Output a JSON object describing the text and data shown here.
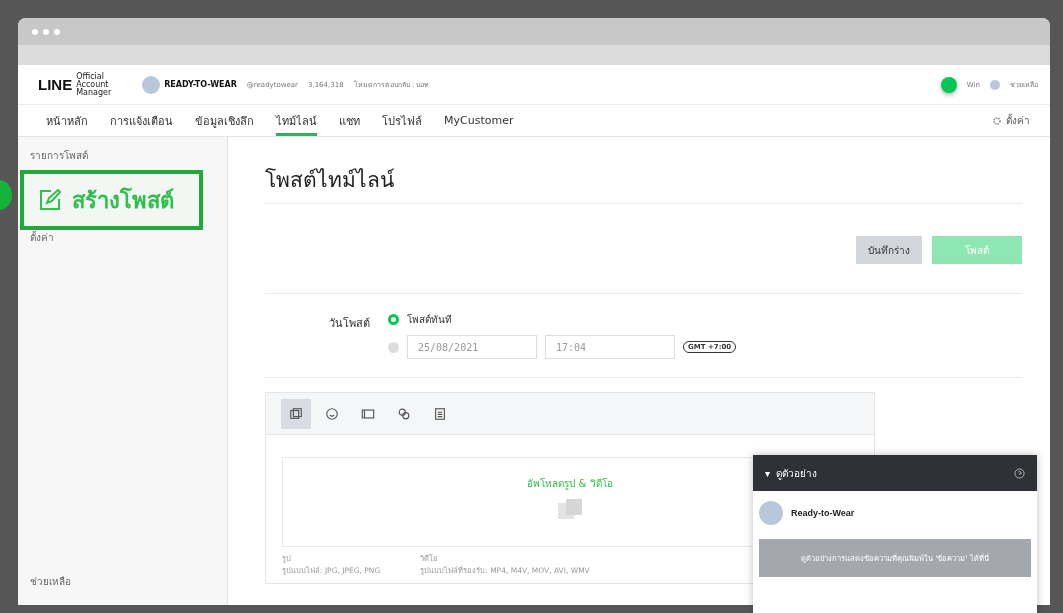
{
  "header": {
    "logo": "LINE",
    "logo_sub": "Official Account Manager",
    "account_name": "READY-TO-WEAR",
    "account_id": "@readytowear",
    "friends": "3,164,318",
    "reply_mode": "โหมดการตอบกลับ : บอท",
    "user": "Win",
    "help": "ช่วยเหลือ"
  },
  "nav": {
    "tabs": [
      {
        "label": "หน้าหลัก",
        "selected": false
      },
      {
        "label": "การแจ้งเตือน",
        "selected": false
      },
      {
        "label": "ข้อมูลเชิงลึก",
        "selected": false
      },
      {
        "label": "ไทม์ไลน์",
        "selected": true
      },
      {
        "label": "แชท",
        "selected": false
      },
      {
        "label": "โปรไฟล์",
        "selected": false
      },
      {
        "label": "MyCustomer",
        "selected": false
      }
    ],
    "settings": "ตั้งค่า"
  },
  "sidebar": {
    "items": [
      {
        "label": "รายการโพสต์"
      },
      {
        "label": "ตั้งค่า"
      }
    ],
    "callout": "สร้างโพสต์",
    "footer": "ช่วยเหลือ"
  },
  "main": {
    "title": "โพสต์ไทม์ไลน์",
    "buttons": [
      {
        "label": "บันทึกร่าง",
        "kind": "draft",
        "disabled": false
      },
      {
        "label": "โพสต์",
        "kind": "post",
        "disabled": true
      }
    ],
    "date_label": "วันโพสต์",
    "schedule": [
      {
        "kind": "now",
        "label": "โพสต์ทันที",
        "selected": true
      },
      {
        "kind": "scheduled",
        "date": "25/08/2021",
        "time": "17:04",
        "timezone": "GMT +7:00",
        "selected": false
      }
    ],
    "toolbar": [
      {
        "kind": "photo",
        "selected": true
      },
      {
        "kind": "emoji",
        "selected": false
      },
      {
        "kind": "card",
        "selected": false
      },
      {
        "kind": "link",
        "selected": false
      },
      {
        "kind": "clipboard",
        "selected": false
      }
    ],
    "upload": {
      "label": "อัพโหลดรูป & วิดีโอ",
      "hints": [
        {
          "title": "รูป",
          "formats": "รูปแบบไฟล์: JPG, JPEG, PNG"
        },
        {
          "title": "วิดีโอ",
          "formats": "รูปแบบไฟล์ที่รองรับ: MP4, M4V, MOV, AVI, WMV"
        }
      ]
    }
  },
  "preview": {
    "caret": "▾",
    "title": "ดูตัวอย่าง",
    "name": "Ready-to-Wear",
    "placeholder": "ดูตัวอย่างการแสดงข้อความที่คุณพิมพ์ใน 'ข้อความ' ได้ที่นี่"
  }
}
